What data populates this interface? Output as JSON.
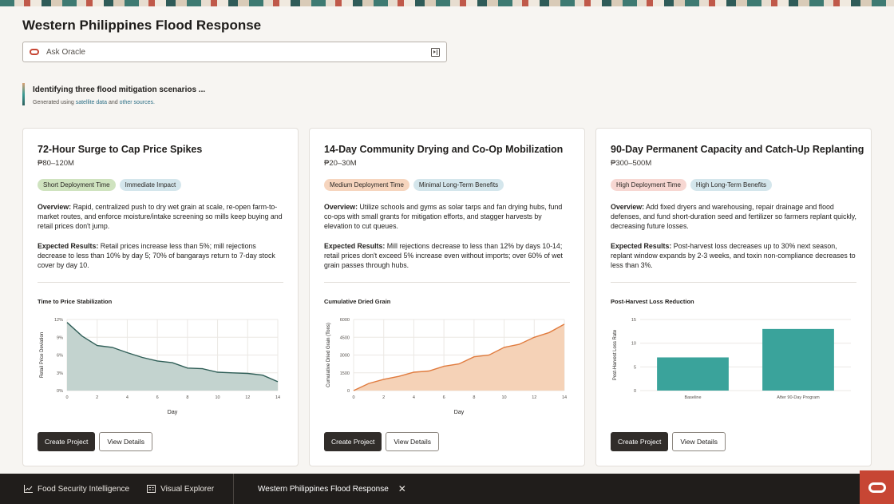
{
  "page": {
    "title": "Western Philippines Flood Response"
  },
  "ask": {
    "placeholder": "Ask Oracle"
  },
  "status": {
    "title": "Identifying three flood mitigation scenarios ...",
    "sub_prefix": "Generated using",
    "link1": "satellite data",
    "sub_and": "and",
    "link2": "other sources."
  },
  "cards": [
    {
      "title": "72-Hour Surge to Cap Price Spikes",
      "cost": "₱80–120M",
      "tag1": "Short Deployment Time",
      "tag2": "Immediate Impact",
      "overview_label": "Overview:",
      "overview": "Rapid, centralized push to dry wet grain at scale, re-open farm-to-market routes, and enforce moisture/intake screening so mills keep buying and retail prices don't jump.",
      "results_label": "Expected Results:",
      "results": "Retail prices increase less than 5%; mill rejections decrease to less than 10% by day 5; 70% of bangarays return to 7-day stock cover by day 10.",
      "chart_title": "Time to Price Stabilization",
      "create": "Create Project",
      "details": "View Details"
    },
    {
      "title": "14-Day Community Drying and Co-Op Mobilization",
      "cost": "₱20–30M",
      "tag1": "Medium Deployment Time",
      "tag2": "Minimal Long-Term Benefits",
      "overview_label": "Overview:",
      "overview": "Utilize schools and gyms as solar tarps and fan drying hubs, fund co-ops with small grants for mitigation efforts, and stagger harvests by elevation to cut queues.",
      "results_label": "Expected Results:",
      "results": "Mill rejections decrease to less than 12% by days 10-14; retail prices don't exceed 5% increase even without imports; over 60% of wet grain passes through hubs.",
      "chart_title": "Cumulative Dried Grain",
      "create": "Create Project",
      "details": "View Details"
    },
    {
      "title": "90-Day Permanent Capacity and Catch-Up Replanting",
      "cost": "₱300–500M",
      "tag1": "High Deployment Time",
      "tag2": "High Long-Term Benefits",
      "overview_label": "Overview:",
      "overview": "Add fixed dryers and warehousing, repair drainage and flood defenses, and fund short-duration seed and fertilizer so farmers replant quickly, decreasing future losses.",
      "results_label": "Expected Results:",
      "results": "Post-harvest loss decreases up to 30% next season, replant window expands by 2-3 weeks, and toxin non-compliance decreases to less than 3%.",
      "chart_title": "Post-Harvest Loss Reduction",
      "create": "Create Project",
      "details": "View Details"
    }
  ],
  "chart_data": [
    {
      "type": "area",
      "title": "Time to Price Stabilization",
      "xlabel": "Day",
      "ylabel": "Retail Price Deviation",
      "x": [
        0,
        1,
        2,
        3,
        4,
        5,
        6,
        7,
        8,
        9,
        10,
        11,
        12,
        13,
        14
      ],
      "values": [
        11.5,
        9.2,
        7.6,
        7.3,
        6.4,
        5.6,
        5.0,
        4.7,
        3.8,
        3.7,
        3.1,
        3.0,
        2.9,
        2.6,
        1.5
      ],
      "ylim": [
        0,
        12
      ],
      "yticks": [
        "0%",
        "3%",
        "6%",
        "9%",
        "12%"
      ],
      "xticks": [
        "0",
        "2",
        "4",
        "6",
        "8",
        "10",
        "12",
        "14"
      ],
      "color": "#2f5e57",
      "fill": "#c3d3cf"
    },
    {
      "type": "area",
      "title": "Cumulative Dried Grain",
      "xlabel": "Day",
      "ylabel": "Cumulative Dried Grain (Tons)",
      "x": [
        0,
        1,
        2,
        3,
        4,
        5,
        6,
        7,
        8,
        9,
        10,
        11,
        12,
        13,
        14
      ],
      "values": [
        0,
        600,
        950,
        1200,
        1550,
        1650,
        2050,
        2250,
        2850,
        3000,
        3650,
        3900,
        4500,
        4900,
        5600
      ],
      "ylim": [
        0,
        6000
      ],
      "yticks": [
        "0",
        "1500",
        "3000",
        "4500",
        "6000"
      ],
      "xticks": [
        "0",
        "2",
        "4",
        "6",
        "8",
        "10",
        "12",
        "14"
      ],
      "color": "#e07b3e",
      "fill": "#f5d2b7"
    },
    {
      "type": "bar",
      "title": "Post-Harvest Loss Reduction",
      "xlabel": "",
      "ylabel": "Post-Harvest Loss Rate",
      "categories": [
        "Baseline",
        "After 90-Day Program"
      ],
      "values": [
        7,
        13
      ],
      "ylim": [
        0,
        15
      ],
      "yticks": [
        "0",
        "5",
        "10",
        "15"
      ],
      "color": "#3aa39b"
    }
  ],
  "bottom_nav": {
    "item1": "Food Security Intelligence",
    "item2": "Visual Explorer",
    "active_tab": "Western Philippines Flood Response"
  }
}
